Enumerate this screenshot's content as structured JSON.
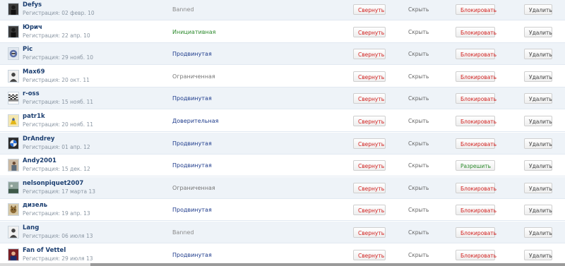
{
  "buttons": {
    "collapse": "Свернуть",
    "hide": "Скрыть",
    "block": "Блокировать",
    "allow": "Разрешить",
    "delete": "Удалить"
  },
  "status_colors": {
    "Banned": "#8a8a8a",
    "Инициативная": "#2e8b2e",
    "Продвинутая": "#1f3c8c",
    "Ограниченная": "#777777",
    "Доверительная": "#1f3c8c"
  },
  "users": [
    {
      "name": "Defys",
      "registered": "Регистрация: 02 февр. 10",
      "status": "Banned",
      "action": "block",
      "avatar_icon": "dark-figure-icon"
    },
    {
      "name": "Юрич",
      "registered": "Регистрация: 22 апр. 10",
      "status": "Инициативная",
      "action": "block",
      "avatar_icon": "dark-figure-icon"
    },
    {
      "name": "Pic",
      "registered": "Регистрация: 29 нояб. 10",
      "status": "Продвинутая",
      "action": "block",
      "avatar_icon": "helmet-icon"
    },
    {
      "name": "Max69",
      "registered": "Регистрация: 20 окт. 11",
      "status": "Ограниченная",
      "action": "block",
      "avatar_icon": "default-avatar-icon"
    },
    {
      "name": "r-oss",
      "registered": "Регистрация: 15 нояб. 11",
      "status": "Продвинутая",
      "action": "block",
      "avatar_icon": "checkered-flag-icon"
    },
    {
      "name": "patr1k",
      "registered": "Регистрация: 20 нояб. 11",
      "status": "Доверительная",
      "action": "block",
      "avatar_icon": "yellow-figure-icon"
    },
    {
      "name": "DrAndrey",
      "registered": "Регистрация: 01 апр. 12",
      "status": "Продвинутая",
      "action": "block",
      "avatar_icon": "car-badge-icon"
    },
    {
      "name": "Andy2001",
      "registered": "Регистрация: 15 дек. 12",
      "status": "Продвинутая",
      "action": "allow",
      "avatar_icon": "photo-figure-icon"
    },
    {
      "name": "nelsonpiquet2007",
      "registered": "Регистрация: 17 марта 13",
      "status": "Ограниченная",
      "action": "block",
      "avatar_icon": "landscape-icon"
    },
    {
      "name": "дизель",
      "registered": "Регистрация: 19 апр. 13",
      "status": "Продвинутая",
      "action": "block",
      "avatar_icon": "cat-icon"
    },
    {
      "name": "Lang",
      "registered": "Регистрация: 06 июля 13",
      "status": "Banned",
      "action": "block",
      "avatar_icon": "default-avatar-icon"
    },
    {
      "name": "Fan of Vettel",
      "registered": "Регистрация: 29 июля 13",
      "status": "Продвинутая",
      "action": "block",
      "avatar_icon": "portrait-icon"
    }
  ]
}
